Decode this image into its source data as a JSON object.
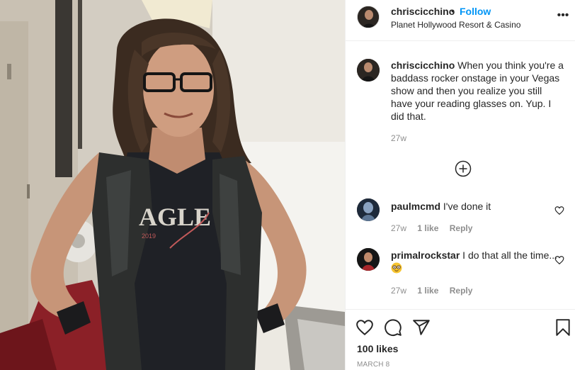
{
  "post": {
    "username": "chriscicchino",
    "follow_label": "Follow",
    "separator": "•",
    "location": "Planet Hollywood Resort & Casino",
    "more_label": "•••",
    "photo_shirt_text": "AGLE",
    "photo_shirt_year": "2019"
  },
  "caption": {
    "username": "chriscicchino",
    "text": "When you think you're a baddass rocker onstage in your Vegas show and then you realize you still have your reading glasses on. Yup. I did that.",
    "time": "27w"
  },
  "comments": [
    {
      "username": "paulmcmd",
      "text": "I've done it",
      "time": "27w",
      "likes": "1 like",
      "reply": "Reply"
    },
    {
      "username": "primalrockstar",
      "text": "I do that all the time...",
      "emoji": "face-with-glasses",
      "time": "27w",
      "likes": "1 like",
      "reply": "Reply"
    }
  ],
  "actions": {
    "likes": "100 likes",
    "date": "MARCH 8"
  },
  "icons": {
    "like": "heart-icon",
    "comment": "comment-bubble-icon",
    "share": "paper-plane-icon",
    "save": "bookmark-icon",
    "load_more": "plus-circle-icon"
  },
  "colors": {
    "follow": "#0095f6",
    "text": "#262626",
    "muted": "#8e8e8e",
    "border": "#efefef"
  }
}
